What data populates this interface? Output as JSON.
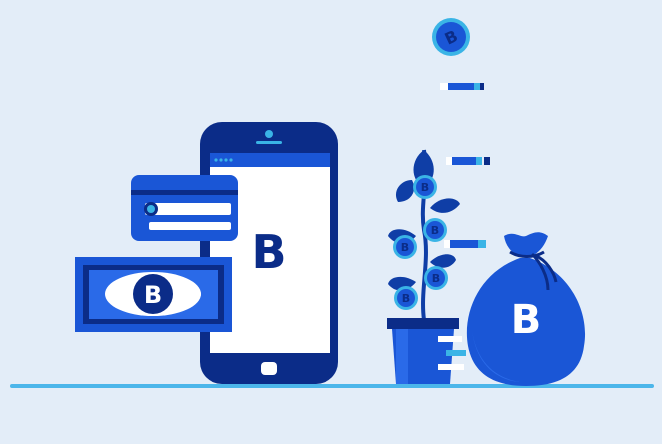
{
  "glyphs": {
    "bitcoin": "B"
  },
  "colors": {
    "background": "#e3edf8",
    "navy": "#0b2c88",
    "blue": "#1a56d6",
    "mid_blue": "#2a6ae8",
    "cyan": "#3ab4e6",
    "white": "#ffffff",
    "ground": "#4cb6ea",
    "leaf": "#0f3ea6"
  },
  "icons": [
    "smartphone-icon",
    "credit-card-icon",
    "banknote-icon",
    "plant-icon",
    "money-bag-icon",
    "bitcoin-coin-icon"
  ]
}
